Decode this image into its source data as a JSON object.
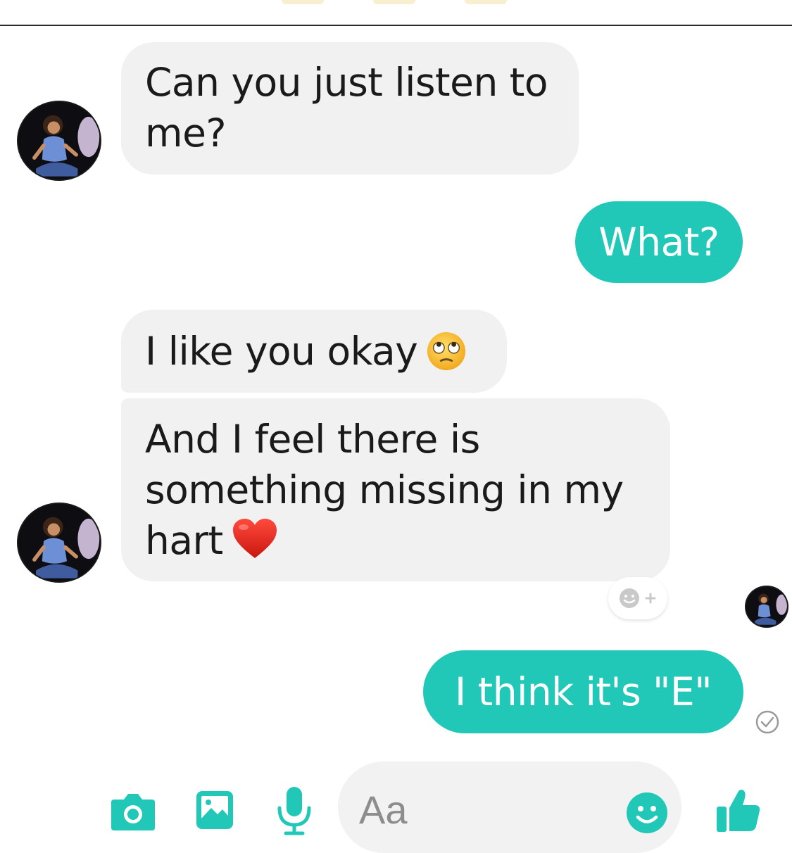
{
  "colors": {
    "accent": "#21c8b8",
    "incoming_bubble": "#f1f1f1",
    "outgoing_text": "#ffffff"
  },
  "messages": [
    {
      "direction": "incoming",
      "text": "Can you just listen to me?"
    },
    {
      "direction": "outgoing",
      "text": "What?"
    },
    {
      "direction": "incoming",
      "text": "I like you okay",
      "emoji": "face-with-rolling-eyes"
    },
    {
      "direction": "incoming",
      "text": "And I feel there is something missing in my hart",
      "emoji": "red-heart"
    },
    {
      "direction": "outgoing",
      "text": "I think it's \"E\""
    }
  ],
  "composer": {
    "placeholder": "Aa"
  },
  "icons": [
    "camera-icon",
    "gallery-icon",
    "microphone-icon",
    "emoji-icon",
    "thumbs-up-icon",
    "add-reaction-icon",
    "seen-check-icon"
  ]
}
